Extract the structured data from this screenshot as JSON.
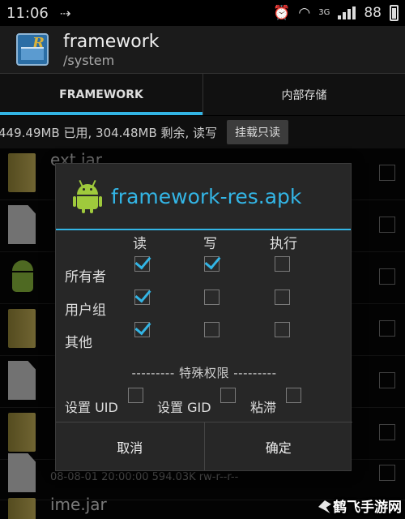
{
  "status_bar": {
    "time": "11:06",
    "battery": "88",
    "network": "3G"
  },
  "app_bar": {
    "title": "framework",
    "subtitle": "/system"
  },
  "tabs": [
    {
      "label": "FRAMEWORK",
      "active": true
    },
    {
      "label": "内部存储",
      "active": false
    }
  ],
  "storage": {
    "text": "449.49MB 已用, 304.48MB 剩余, 读写",
    "mount_button": "挂载只读"
  },
  "file_list": [
    {
      "icon": "folder-icon",
      "name": "ext.jar",
      "meta": ""
    },
    {
      "icon": "document-icon",
      "name": "",
      "meta": ""
    },
    {
      "icon": "android-icon",
      "name": "",
      "meta": ""
    },
    {
      "icon": "folder-icon",
      "name": "",
      "meta": ""
    },
    {
      "icon": "document-icon",
      "name": "",
      "meta": ""
    },
    {
      "icon": "folder-icon",
      "name": "",
      "meta": ""
    },
    {
      "icon": "document-icon",
      "name": "",
      "meta": "08-08-01 20:00:00   594.03K   rw-r--r--"
    },
    {
      "icon": "folder-icon",
      "name": "ime.jar",
      "meta": ""
    }
  ],
  "dialog": {
    "title": "framework-res.apk",
    "columns": [
      "读",
      "写",
      "执行"
    ],
    "rows": [
      {
        "label": "所有者",
        "read": true,
        "write": true,
        "execute": false
      },
      {
        "label": "用户组",
        "read": true,
        "write": false,
        "execute": false
      },
      {
        "label": "其他",
        "read": true,
        "write": false,
        "execute": false
      }
    ],
    "special_header": "--------- 特殊权限 ---------",
    "special": [
      {
        "label": "设置 UID",
        "checked": false
      },
      {
        "label": "设置 GID",
        "checked": false
      },
      {
        "label": "粘滞",
        "checked": false
      }
    ],
    "cancel": "取消",
    "ok": "确定"
  },
  "watermark": "鹤飞手游网",
  "colors": {
    "accent": "#33b5e5",
    "android_green": "#9fca3c"
  }
}
